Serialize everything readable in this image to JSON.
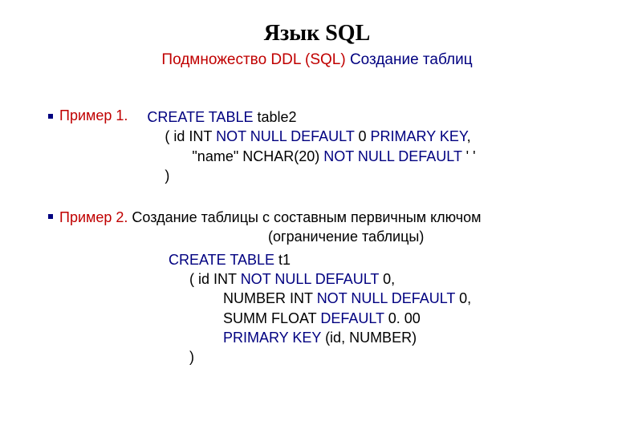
{
  "title": "Язык SQL",
  "subtitle": {
    "red": "Подмножество DDL (SQL)",
    "navy": " Создание таблиц"
  },
  "example1": {
    "label": "Пример 1.",
    "line1_navy": "CREATE TABLE ",
    "line1_rest": "table2",
    "line2_a": "(   id INT ",
    "line2_navy": "NOT NULL DEFAULT ",
    "line2_b": "0 ",
    "line2_navy2": "PRIMARY KEY",
    "line2_c": ",",
    "line3_a": "\"name\" NCHAR(20) ",
    "line3_navy": "NOT NULL DEFAULT ",
    "line3_b": "' '",
    "line4": ")"
  },
  "example2": {
    "label": "Пример 2.",
    "text": " Создание таблицы с составным первичным ключом",
    "note": "(ограничение таблицы)",
    "code": {
      "l1_navy": "CREATE TABLE ",
      "l1_rest": " t1",
      "l2_a": "(     id INT ",
      "l2_navy": "NOT NULL DEFAULT ",
      "l2_b": "0,",
      "l3_a": "NUMBER INT ",
      "l3_navy": "NOT NULL DEFAULT ",
      "l3_b": "0,",
      "l4_a": "SUMM FLOAT ",
      "l4_navy": "DEFAULT ",
      "l4_b": "0. 00",
      "l5_navy": "PRIMARY KEY ",
      "l5_a": "(id, NUMBER)",
      "l6": ")"
    }
  }
}
